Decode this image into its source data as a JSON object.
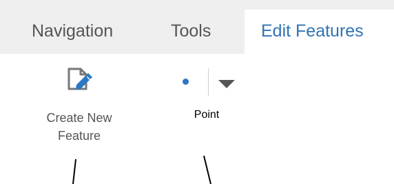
{
  "tabs": [
    {
      "label": "Navigation",
      "active": false
    },
    {
      "label": "Tools",
      "active": false
    },
    {
      "label": "Edit Features",
      "active": true
    }
  ],
  "tools": {
    "create_feature": {
      "label_line1": "Create New",
      "label_line2": "Feature",
      "icon": "document-edit-icon"
    },
    "point": {
      "label": "Point",
      "icon": "point-icon",
      "dropdown_icon": "chevron-down-icon"
    }
  },
  "colors": {
    "tab_bar_bg": "#efefef",
    "active_tab_text": "#2f74b5",
    "inactive_text": "#555555",
    "point_dot": "#2b78c5",
    "icon_gray": "#777777",
    "icon_blue": "#2b78c5"
  }
}
